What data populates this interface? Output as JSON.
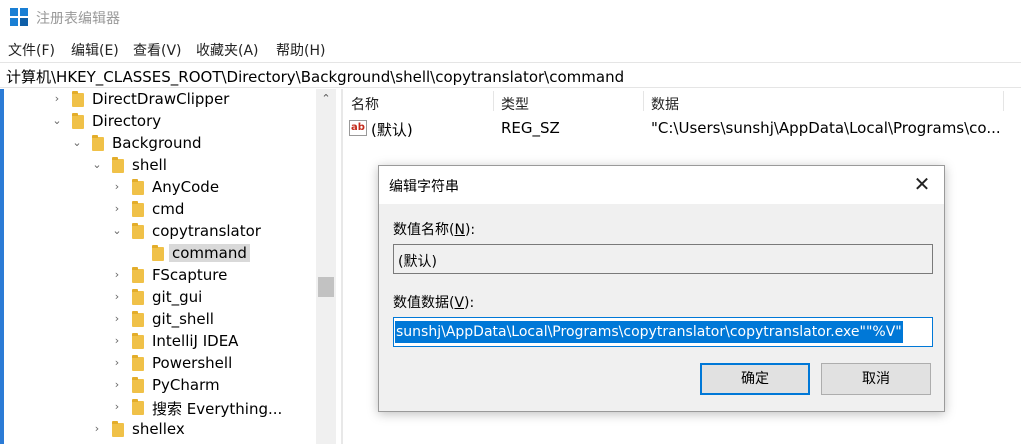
{
  "window": {
    "title": "注册表编辑器"
  },
  "menu": [
    {
      "label": "文件(F)"
    },
    {
      "label": "编辑(E)"
    },
    {
      "label": "查看(V)"
    },
    {
      "label": "收藏夹(A)"
    },
    {
      "label": "帮助(H)"
    }
  ],
  "address": "计算机\\HKEY_CLASSES_ROOT\\Directory\\Background\\shell\\copytranslator\\command",
  "tree": [
    {
      "label": "DirectDrawClipper",
      "expanded": false
    },
    {
      "label": "Directory",
      "expanded": true
    },
    {
      "label": "Background",
      "expanded": true
    },
    {
      "label": "shell",
      "expanded": true
    },
    {
      "label": "AnyCode",
      "expanded": false
    },
    {
      "label": "cmd",
      "expanded": false
    },
    {
      "label": "copytranslator",
      "expanded": true
    },
    {
      "label": "command",
      "selected": true
    },
    {
      "label": "FScapture",
      "expanded": false
    },
    {
      "label": "git_gui",
      "expanded": false
    },
    {
      "label": "git_shell",
      "expanded": false
    },
    {
      "label": "IntelliJ IDEA",
      "expanded": false
    },
    {
      "label": "Powershell",
      "expanded": false
    },
    {
      "label": "PyCharm",
      "expanded": false
    },
    {
      "label": "搜索 Everything...",
      "expanded": false
    },
    {
      "label": "shellex",
      "expanded": false
    }
  ],
  "list": {
    "columns": [
      "名称",
      "类型",
      "数据"
    ],
    "rows": [
      {
        "name": "(默认)",
        "type": "REG_SZ",
        "data": "\"C:\\Users\\sunshj\\AppData\\Local\\Programs\\co..."
      }
    ]
  },
  "dialog": {
    "title": "编辑字符串",
    "name_label": "数值名称(",
    "name_key": "N",
    "name_label_end": "):",
    "name_value": "(默认)",
    "data_label": "数值数据(",
    "data_key": "V",
    "data_label_end": "):",
    "data_value": "sunshj\\AppData\\Local\\Programs\\copytranslator\\copytranslator.exe\"\"%V\"",
    "ok_label": "确定",
    "cancel_label": "取消"
  },
  "colors": {
    "accent": "#0078d7",
    "folder": "#f0c148",
    "selection": "#d9d9d9"
  }
}
